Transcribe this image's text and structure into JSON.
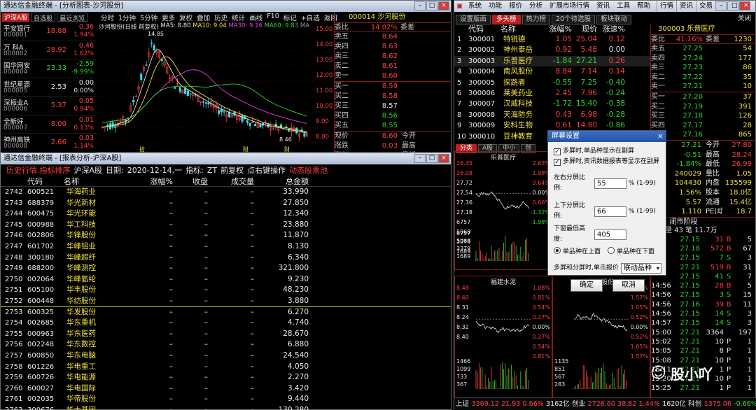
{
  "left_window": {
    "title": "通达信金融终端 - [分析图表-沙河股份]",
    "market_tabs": [
      "沪深A股",
      "自选股",
      "最近浏览"
    ],
    "stock_list": [
      {
        "name": "平安银行",
        "code": "000001",
        "price": "18.88",
        "change": "0.36",
        "pct": "1.94%"
      },
      {
        "name": "万 科A",
        "code": "000002",
        "price": "28.92",
        "change": "0.46",
        "pct": "1.62%"
      },
      {
        "name": "国华网安",
        "code": "000004",
        "price": "23.33",
        "change": "-2.59",
        "pct": "-9.99%"
      },
      {
        "name": "世纪星源",
        "code": "000005",
        "price": "2.53",
        "change": "0.00",
        "pct": "0.00%"
      },
      {
        "name": "深振业A",
        "code": "000006",
        "price": "5.37",
        "change": "0.05",
        "pct": "0.94%"
      },
      {
        "name": "全新好",
        "code": "000007",
        "price": "8.00",
        "change": "0.01",
        "pct": "0.13%"
      },
      {
        "name": "神州高铁",
        "code": "000008",
        "price": "2.66",
        "change": "0.03",
        "pct": "1.14%"
      }
    ],
    "chart_toolbar": [
      "分时",
      "1分钟",
      "5分钟",
      "更多",
      "复权",
      "叠加",
      "历史",
      "统计",
      "画线",
      "F10",
      "标记",
      "+自选",
      "返回"
    ],
    "chart_info": {
      "label": "沙河股份(日线 前复权)",
      "ma5": "MA5: 8.80",
      "ma10": "MA10: 9.04",
      "ma30": "MA30: 9.16",
      "ma60": "MA60: 9.83",
      "ma_tail": "MA",
      "high_label": "14.85",
      "low_label": "8.46",
      "yaxis": [
        "15.00",
        "14.00",
        "13.00",
        "12.00",
        "11.00",
        "10.00",
        "9.00",
        "8.00"
      ],
      "markers": [
        "拾",
        "财",
        "财"
      ]
    },
    "quote": {
      "code": "000014",
      "name": "沙河股份",
      "weibi_label": "委比",
      "weibi": "14.02%",
      "weicha_label": "委差",
      "weicha": "",
      "asks": [
        {
          "label": "卖五",
          "price": "8.64"
        },
        {
          "label": "卖四",
          "price": "8.63"
        },
        {
          "label": "卖三",
          "price": "8.62"
        },
        {
          "label": "卖二",
          "price": "8.61"
        },
        {
          "label": "卖一",
          "price": "8.60"
        }
      ],
      "bids": [
        {
          "label": "买一",
          "price": "8.59"
        },
        {
          "label": "买二",
          "price": "8.58"
        },
        {
          "label": "买三",
          "price": "8.57"
        },
        {
          "label": "买四",
          "price": "8.56"
        },
        {
          "label": "买五",
          "price": "8.55"
        }
      ],
      "summary": [
        {
          "l": "现价",
          "v": "8.60",
          "l2": "今开"
        },
        {
          "l": "涨跌",
          "v": "0.03",
          "l2": "最高"
        },
        {
          "l": "涨幅",
          "v": "0.35%",
          "l2": "最低"
        }
      ]
    }
  },
  "history_window": {
    "title": "通达信金融终端 - [报表分析-沪深A股]",
    "header": {
      "a": "历史行情.指标排序",
      "b": "沪深A股",
      "c": "日期:",
      "d": "2020-12-14,一",
      "e": "指标:",
      "f": "ZT",
      "g": "前复权",
      "h": "点右键操作",
      "i": "动态股票池"
    },
    "columns": [
      "代码",
      "名称",
      "涨幅%",
      "收盘",
      "成交量",
      "总金额"
    ],
    "rows": [
      {
        "n": "2742",
        "code": "600521",
        "name": "华海药业",
        "amt": "33.990"
      },
      {
        "n": "2743",
        "code": "688379",
        "name": "华光新材",
        "amt": "27.850"
      },
      {
        "n": "2744",
        "code": "600475",
        "name": "华光环能",
        "amt": "12.340"
      },
      {
        "n": "2745",
        "code": "000988",
        "name": "华工科技",
        "amt": "23.880"
      },
      {
        "n": "2746",
        "code": "002806",
        "name": "华锋股份",
        "amt": "11.870"
      },
      {
        "n": "2747",
        "code": "601702",
        "name": "华峰铝业",
        "amt": "8.130"
      },
      {
        "n": "2748",
        "code": "300180",
        "name": "华峰超纤",
        "amt": "6.340"
      },
      {
        "n": "2749",
        "code": "688200",
        "name": "华峰测控",
        "amt": "321.800"
      },
      {
        "n": "2750",
        "code": "002064",
        "name": "华峰氨纶",
        "amt": "9.230"
      },
      {
        "n": "2751",
        "code": "605100",
        "name": "华丰股份",
        "amt": "48.230"
      },
      {
        "n": "2752",
        "code": "600448",
        "name": "华纺股份",
        "amt": "3.880"
      },
      {
        "n": "2753",
        "code": "600325",
        "name": "华发股份",
        "amt": "6.270"
      },
      {
        "n": "2754",
        "code": "002685",
        "name": "华东重机",
        "amt": "4.740"
      },
      {
        "n": "2755",
        "code": "000963",
        "name": "华东医药",
        "amt": "28.670"
      },
      {
        "n": "2756",
        "code": "002248",
        "name": "华东数控",
        "amt": "6.880"
      },
      {
        "n": "2757",
        "code": "600850",
        "name": "华东电脑",
        "amt": "24.540"
      },
      {
        "n": "2758",
        "code": "601226",
        "name": "华电重工",
        "amt": "4.050"
      },
      {
        "n": "2759",
        "code": "600726",
        "name": "华电能源",
        "amt": "2.270"
      },
      {
        "n": "2760",
        "code": "600027",
        "name": "华电国际",
        "amt": "3.420"
      },
      {
        "n": "2761",
        "code": "002035",
        "name": "华帝股份",
        "amt": "9.440"
      },
      {
        "n": "2762",
        "code": "300676",
        "name": "华大基因",
        "amt": "130.280"
      }
    ],
    "dash": "–"
  },
  "right_window": {
    "menu": [
      "系统",
      "功能",
      "报价",
      "分析",
      "扩展市场行情",
      "资讯",
      "工具",
      "帮助"
    ],
    "menu_right": [
      "行情",
      "资讯",
      "交易"
    ],
    "close_label": "关闭",
    "tabs": [
      "设置版面",
      "多头榜",
      "热力榜",
      "20个待选股",
      "板块联动"
    ],
    "columns": [
      "代码",
      "名称",
      "涨幅%",
      "现价",
      "涨速%"
    ],
    "rows": [
      {
        "n": "1",
        "code": "300001",
        "name": "特锐德",
        "pct": "1.05",
        "price": "25.04",
        "spd": "0.12"
      },
      {
        "n": "2",
        "code": "300002",
        "name": "神州泰岳",
        "pct": "0.92",
        "price": "5.48",
        "spd": "0.00"
      },
      {
        "n": "3",
        "code": "300003",
        "name": "乐普医疗",
        "pct": "-1.84",
        "price": "27.21",
        "spd": "0.26"
      },
      {
        "n": "4",
        "code": "300004",
        "name": "南风股份",
        "pct": "8.84",
        "price": "7.14",
        "spd": "0.14"
      },
      {
        "n": "5",
        "code": "300005",
        "name": "探路者",
        "pct": "-0.55",
        "price": "7.25",
        "spd": "-0.40"
      },
      {
        "n": "6",
        "code": "300006",
        "name": "莱美药业",
        "pct": "2.45",
        "price": "7.96",
        "spd": "-0.24"
      },
      {
        "n": "7",
        "code": "300007",
        "name": "汉威科技",
        "pct": "-1.72",
        "price": "15.40",
        "spd": "-0.38"
      },
      {
        "n": "8",
        "code": "300008",
        "name": "天海防务",
        "pct": "0.43",
        "price": "6.98",
        "spd": "-0.28"
      },
      {
        "n": "9",
        "code": "300009",
        "name": "安科生物",
        "pct": "0.61",
        "price": "14.80",
        "spd": "-0.86"
      },
      {
        "n": "10",
        "code": "300010",
        "name": "豆神教育",
        "pct": "",
        "price": "",
        "spd": ""
      }
    ],
    "sub_tabs": [
      "分类",
      "A股",
      "中小",
      "创"
    ],
    "minis": [
      {
        "name": "乐普医疗",
        "yl": [
          "26.45",
          "26.08",
          "27.72",
          "27.54",
          "27.36",
          "27.18",
          "6757",
          "5068",
          "3379",
          "1689",
          "09:30",
          "13:00"
        ],
        "yr": [
          "2.63%",
          "1.98%",
          "0.64%",
          "0.00%",
          "0.66%",
          "-1.32%",
          "-1.98%"
        ],
        "vol": [
          "6757",
          "5068",
          "3379",
          "1689"
        ]
      },
      {
        "name": "福建水泥",
        "yl": [
          "8.48",
          "8.40",
          "8.31",
          "8.24",
          "8.32",
          "8.40"
        ],
        "yr": [
          "1.08%",
          "0.81%",
          "0.54%",
          "0.27%",
          "0.00%",
          "0.27%",
          "0.54%",
          "0.81%"
        ],
        "vol": [
          "1466",
          "1099",
          "733",
          "367"
        ]
      },
      {
        "name": "新西股份",
        "yl": [],
        "yr": [
          "2.10%",
          "1.57%",
          "1.05%",
          "0.52%",
          "0.00%",
          "0.52%",
          "1.05%",
          "1.57%"
        ],
        "vol": [
          "1135",
          "851",
          "567",
          "283"
        ]
      }
    ],
    "side": {
      "code": "300003",
      "name": "乐普医疗",
      "weibi_l": "委比",
      "weibi": "41.16%",
      "weicha_l": "委差",
      "weicha": "1230",
      "asks": [
        {
          "l": "卖五",
          "p": "27.25",
          "v": "54"
        },
        {
          "l": "卖四",
          "p": "27.24",
          "v": "177"
        },
        {
          "l": "卖三",
          "p": "27.23",
          "v": "86"
        },
        {
          "l": "卖二",
          "p": "27.22",
          "v": "35"
        },
        {
          "l": "卖一",
          "p": "27.21",
          "v": "10"
        }
      ],
      "bids": [
        {
          "l": "买一",
          "p": "27.20",
          "v": "37"
        },
        {
          "l": "买二",
          "p": "27.19",
          "v": "391"
        },
        {
          "l": "买三",
          "p": "27.18",
          "v": "126"
        },
        {
          "l": "买四",
          "p": "27.17",
          "v": "28"
        },
        {
          "l": "买五",
          "p": "27.16",
          "v": "865"
        }
      ],
      "stats": [
        {
          "a": "27.21",
          "b": "今开",
          "c": "27.80"
        },
        {
          "a": "-0.51",
          "b": "最高",
          "c": "28.24"
        },
        {
          "a": "-1.84%",
          "b": "最低",
          "c": "26.99"
        },
        {
          "a": "240029",
          "b": "量比",
          "c": "1.05"
        },
        {
          "a": "104430",
          "b": "内盘",
          "c": "135599"
        },
        {
          "a": "1.56%",
          "b": "股本",
          "c": "18.0亿"
        },
        {
          "a": "5.57",
          "b": "流通",
          "c": "15.4亿"
        },
        {
          "a": "1.110",
          "b": "PE(动)",
          "c": "18.7"
        }
      ],
      "status": "状态: 闭市阶段",
      "deal": "交易量 43 笔 11.7万",
      "ticks": [
        {
          "t": "",
          "p": "27.15",
          "v": "31",
          "s": "B",
          "x": "5"
        },
        {
          "t": "",
          "p": "27.18",
          "v": "572",
          "s": "B",
          "x": "67"
        },
        {
          "t": "",
          "p": "27.15",
          "v": "7",
          "s": "S",
          "x": "3"
        },
        {
          "t": "",
          "p": "27.21",
          "v": "519",
          "s": "B",
          "x": "31"
        },
        {
          "t": "",
          "p": "27.15",
          "v": "41",
          "s": "S",
          "x": "7"
        },
        {
          "t": "14:56",
          "p": "27.15",
          "v": "28",
          "s": "B",
          "x": "5"
        },
        {
          "t": "14:56",
          "p": "27.15",
          "v": "3",
          "s": "S",
          "x": "15"
        },
        {
          "t": "14:56",
          "p": "27.16",
          "v": "39",
          "s": "B",
          "x": "11"
        },
        {
          "t": "14:56",
          "p": "27.15",
          "v": "14",
          "s": "S",
          "x": "3"
        },
        {
          "t": "14:57",
          "p": "27.15",
          "v": "14",
          "s": "S",
          "x": "3"
        },
        {
          "t": "15:00",
          "p": "27.21",
          "v": "3364",
          "s": "",
          "x": "197"
        },
        {
          "t": "15:02",
          "p": "27.21",
          "v": "10",
          "s": "P",
          "x": "1"
        },
        {
          "t": "15:05",
          "p": "27.21",
          "v": "8",
          "s": "P",
          "x": "1"
        },
        {
          "t": "15:08",
          "p": "27.21",
          "v": "10",
          "s": "P",
          "x": "1"
        },
        {
          "t": "15:11",
          "p": "27.21",
          "v": "1",
          "s": "P",
          "x": "1"
        },
        {
          "t": "15:20",
          "p": "27.21",
          "v": "10",
          "s": "P",
          "x": "1"
        },
        {
          "t": "15:25",
          "p": "27.21",
          "v": "1",
          "s": "P",
          "x": "1"
        }
      ]
    },
    "statusbar": [
      "上证",
      "3369.12",
      "21.93",
      "0.66%",
      "3162亿",
      "创业",
      "2726.60",
      "38.82",
      "1.44%",
      "1620亿",
      "科创",
      "1375.06",
      "-0.66%"
    ],
    "watermark": "股小吖"
  },
  "dialog": {
    "title": "屏幕设置",
    "check1": "多屏时,单品种显示在副屏",
    "check2": "多屏时,资讯数据报表等显示在副屏",
    "lr_label": "左右分屏比例:",
    "lr_value": "55",
    "lr_hint": "% (1-99)",
    "ud_label": "上下分屏比例:",
    "ud_value": "66",
    "ud_hint": "% (1-99)",
    "min_label": "下窗最低高度:",
    "min_value": "405",
    "radio1": "单品种在上面",
    "radio2": "单品种在下面",
    "click_label": "多屏和分屏时,单击报价",
    "click_value": "联动品种",
    "ok": "确定",
    "cancel": "取消"
  }
}
